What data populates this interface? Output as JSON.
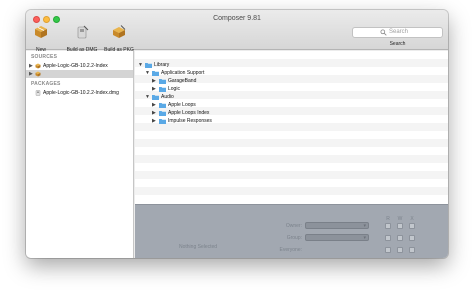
{
  "window": {
    "title": "Composer 9.81"
  },
  "toolbar": {
    "new_label": "New",
    "build_dmg_label": "Build as DMG",
    "build_pkg_label": "Build as PKG",
    "search_placeholder": "Search",
    "search_label": "Search"
  },
  "sidebar": {
    "sources_header": "SOURCES",
    "sources": [
      {
        "label": "Apple-Logic-GB-10.2.2-Index"
      },
      {
        "label": ""
      }
    ],
    "packages_header": "PACKAGES",
    "packages": [
      {
        "label": "Apple-Logic-GB-10.2.2-Index.dmg"
      }
    ]
  },
  "tree": {
    "rows": [
      {
        "label": "Library"
      },
      {
        "label": "Application Support"
      },
      {
        "label": "GarageBand"
      },
      {
        "label": "Logic"
      },
      {
        "label": "Audio"
      },
      {
        "label": "Apple Loops"
      },
      {
        "label": "Apple Loops Index"
      },
      {
        "label": "Impulse Responses"
      }
    ]
  },
  "inspector": {
    "nothing_selected": "Nothing Selected",
    "owner_label": "Owner:",
    "group_label": "Group:",
    "everyone_label": "Everyone:",
    "col_r": "R",
    "col_w": "W",
    "col_x": "X"
  },
  "colors": {
    "folder": "#5aa9e6",
    "selection": "#d4d4d4",
    "inspector_bg": "#a2a8b1"
  }
}
